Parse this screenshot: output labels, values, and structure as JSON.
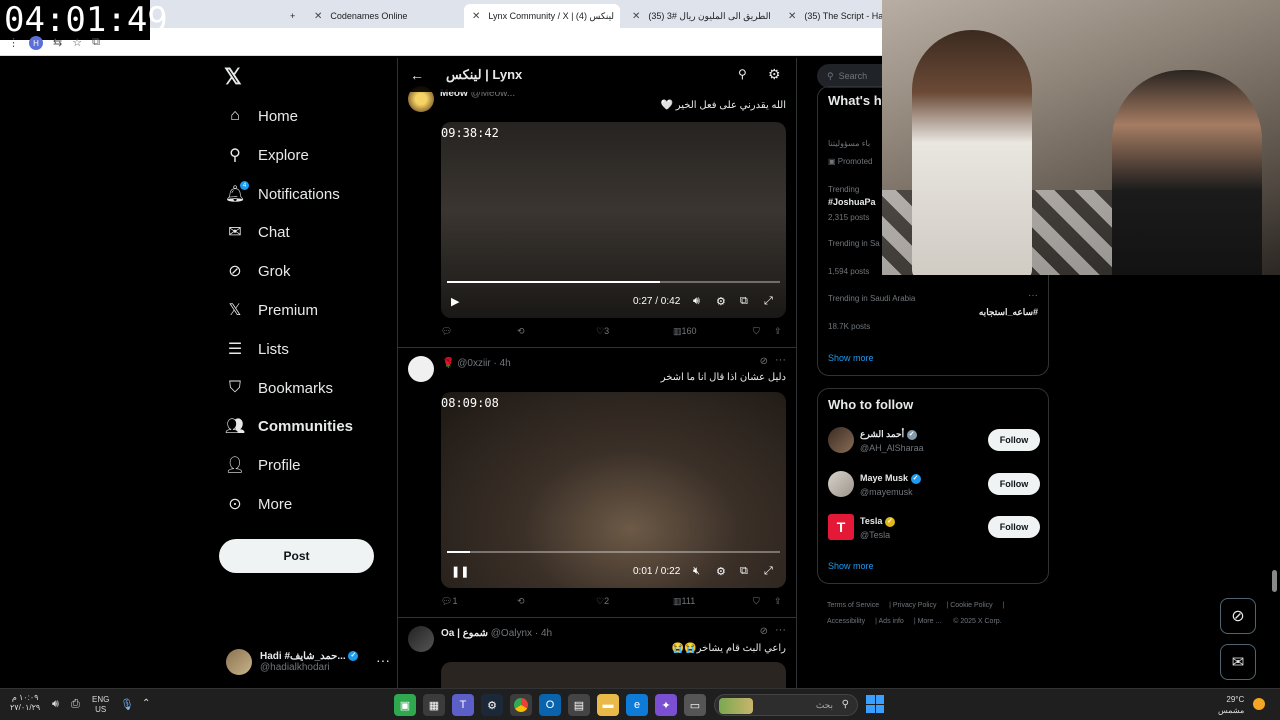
{
  "overlay_clock": "04:01:49",
  "browser": {
    "tabs": [
      {
        "label": "+"
      },
      {
        "label": "Codenames Online"
      },
      {
        "label": "Lynx Community / X | لينكس (4)"
      },
      {
        "label": "الطريق الى المليون ريال #3 (35)"
      },
      {
        "label": "(35) The Script - Hall C"
      }
    ],
    "profile_initial": "H"
  },
  "nav": {
    "items": [
      {
        "label": "Home",
        "icon": "home-icon"
      },
      {
        "label": "Explore",
        "icon": "search-icon"
      },
      {
        "label": "Notifications",
        "icon": "bell-icon",
        "badge": "4"
      },
      {
        "label": "Chat",
        "icon": "mail-icon"
      },
      {
        "label": "Grok",
        "icon": "grok-icon"
      },
      {
        "label": "Premium",
        "icon": "x-logo-icon"
      },
      {
        "label": "Lists",
        "icon": "list-icon"
      },
      {
        "label": "Bookmarks",
        "icon": "bookmark-icon"
      },
      {
        "label": "Communities",
        "icon": "communities-icon"
      },
      {
        "label": "Profile",
        "icon": "person-icon"
      },
      {
        "label": "More",
        "icon": "more-circle-icon"
      }
    ],
    "post_label": "Post",
    "user": {
      "name": "Hadi #حمد_شايف...",
      "handle": "@hadialkhodari"
    }
  },
  "main": {
    "title": "لينكس | Lynx",
    "posts": [
      {
        "author_partial": "Meow",
        "handle_partial": "@Meow...",
        "text": "الله يقدرني على فعل الخير 🤍",
        "video_stamp": "09:38:42",
        "video_time": "0:27 / 0:42",
        "progress": 0.64,
        "playing": false,
        "stats": {
          "replies": "",
          "reposts": "",
          "likes": "3",
          "views": "160"
        }
      },
      {
        "author": "🌹",
        "handle": "@0xziir · 4h",
        "text": "دليل عشان اذا قال انا ما اشخر",
        "video_stamp": "08:09:08",
        "video_time": "0:01 / 0:22",
        "progress": 0.07,
        "playing": true,
        "stats": {
          "replies": "1",
          "reposts": "",
          "likes": "2",
          "views": "111"
        }
      },
      {
        "author": "Oa | شموع",
        "handle": "@Oalynx · 4h",
        "text": "راعي البث قام يشاخر😭😭"
      }
    ]
  },
  "right": {
    "search_placeholder": "Search",
    "whats_happening": {
      "title": "What's h",
      "items": [
        {
          "line1": "باء مسؤوليتنا",
          "line2": "Promoted"
        },
        {
          "meta": "Trending",
          "tag": "#JoshuaPa",
          "count": "2,315 posts"
        },
        {
          "meta": "Trending in Sa",
          "count": "1,594 posts"
        },
        {
          "meta": "Trending in Saudi Arabia",
          "tag": "#ساعه_استجابه",
          "count": "18.7K posts"
        }
      ],
      "show_more": "Show more"
    },
    "who_to_follow": {
      "title": "Who to follow",
      "accounts": [
        {
          "name": "أحمد الشرع",
          "handle": "@AH_AlSharaa",
          "badge": "gray"
        },
        {
          "name": "Maye Musk",
          "handle": "@mayemusk",
          "badge": "blue"
        },
        {
          "name": "Tesla",
          "handle": "@Tesla",
          "badge": "gold"
        }
      ],
      "follow_label": "Follow",
      "show_more": "Show more"
    },
    "footer": [
      "Terms of Service",
      "Privacy Policy",
      "Cookie Policy",
      "Accessibility",
      "Ads info",
      "More ...",
      "© 2025 X Corp."
    ]
  },
  "taskbar": {
    "time": "١٠:٠٩ م",
    "date": "٢٧/٠١/٢٩",
    "lang_top": "ENG",
    "lang_bottom": "US",
    "search_placeholder": "بحث",
    "weather_temp": "29°C",
    "weather_desc": "مشمس"
  }
}
